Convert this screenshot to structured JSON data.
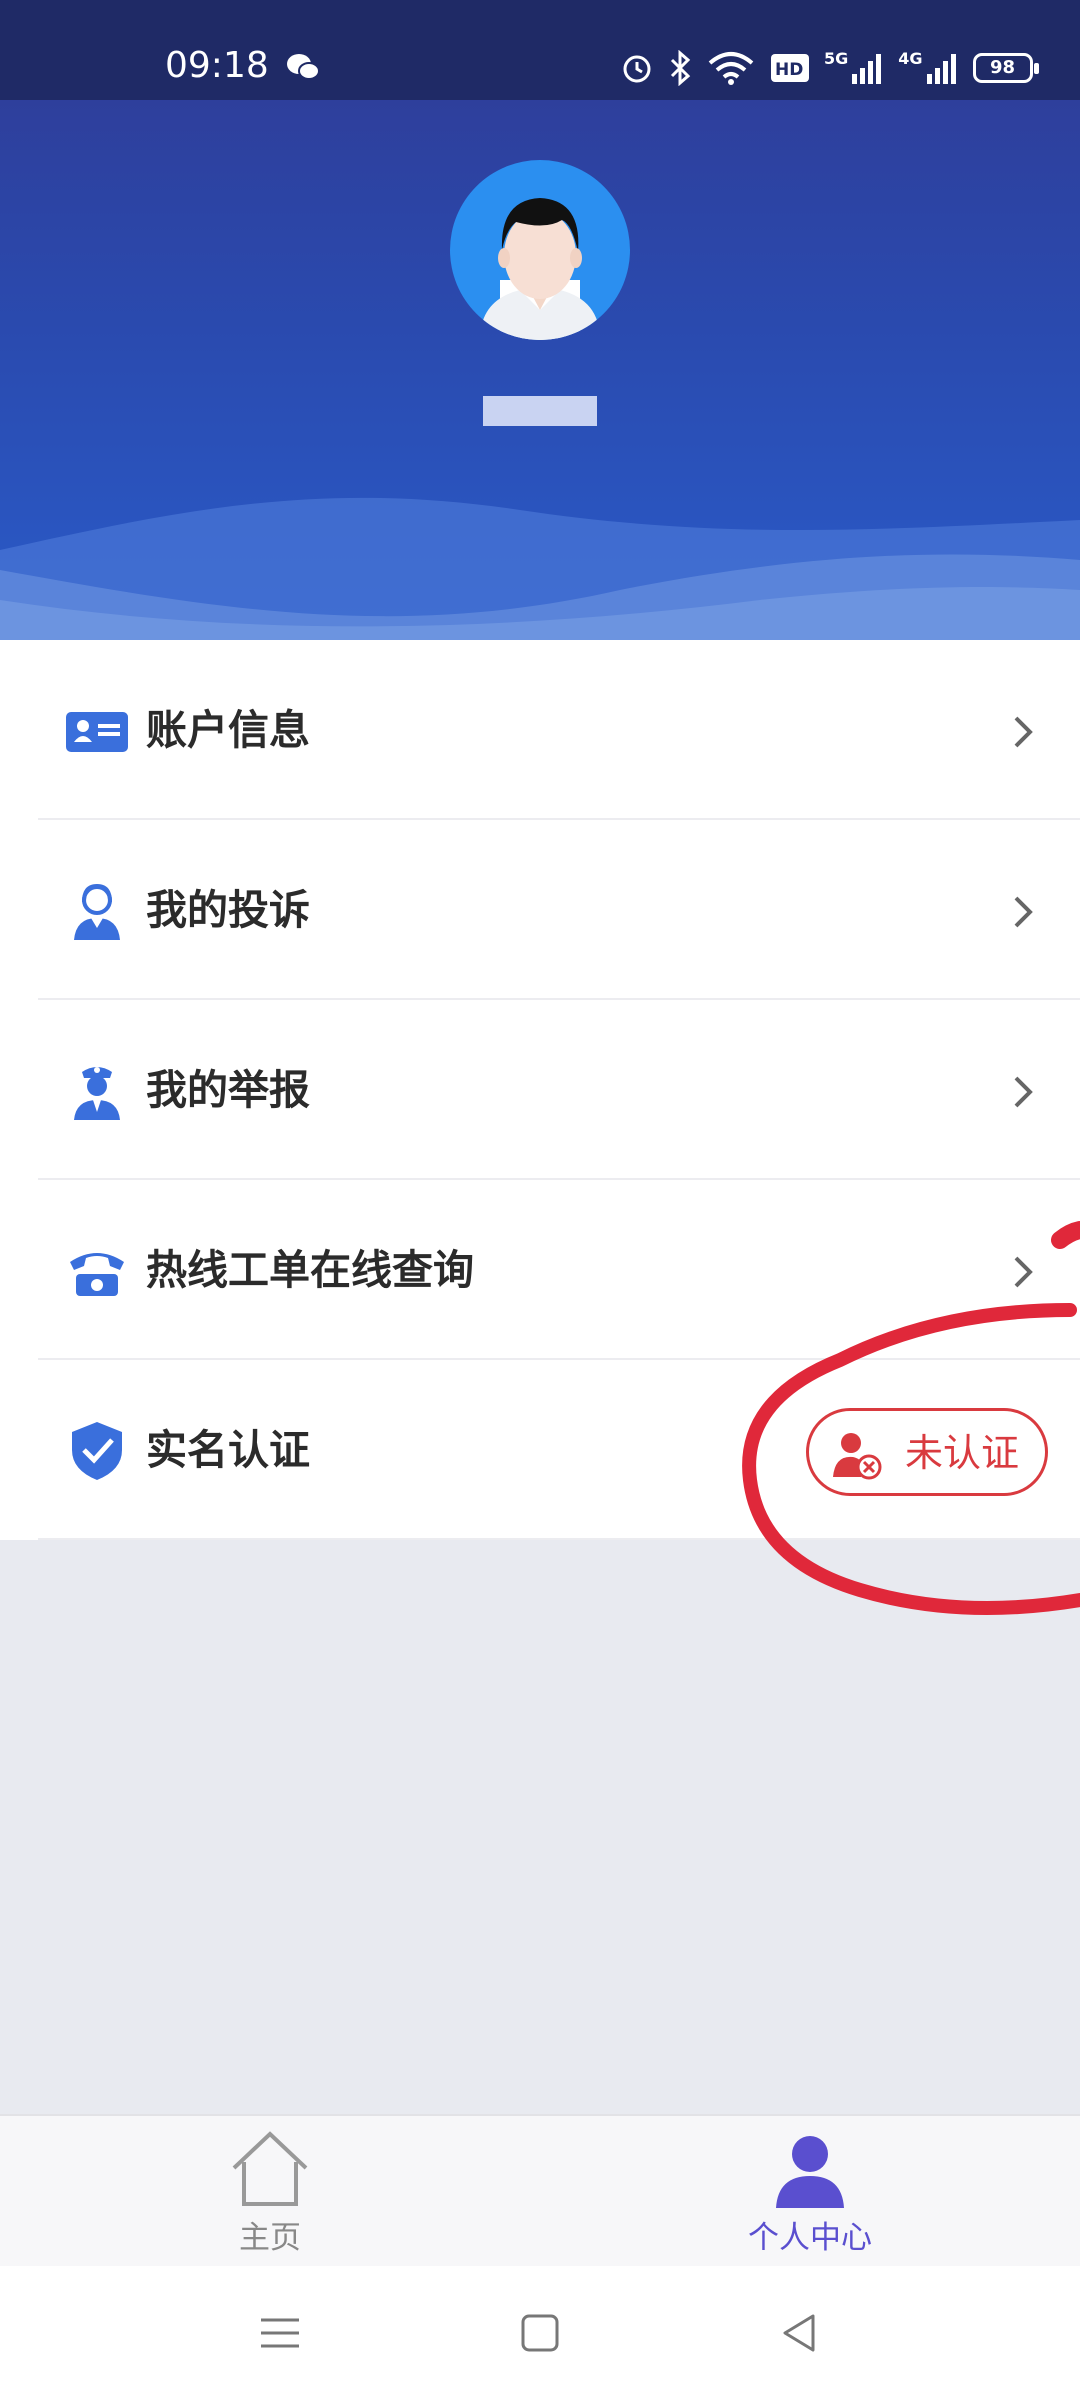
{
  "status_bar": {
    "time": "09:18",
    "battery": "98",
    "net1": "5G",
    "net2": "4G",
    "icons": [
      "wechat-icon",
      "alarm-icon",
      "bluetooth-icon",
      "wifi-icon",
      "hd-icon",
      "signal-icon",
      "battery-icon"
    ]
  },
  "header": {
    "username": "",
    "avatar": "avatar-icon"
  },
  "menu": {
    "items": [
      {
        "label": "账户信息",
        "icon": "id-card-icon"
      },
      {
        "label": "我的投诉",
        "icon": "agent-icon"
      },
      {
        "label": "我的举报",
        "icon": "officer-icon"
      },
      {
        "label": "热线工单在线查询",
        "icon": "telephone-icon"
      },
      {
        "label": "实名认证",
        "icon": "shield-check-icon"
      }
    ],
    "verify_badge": {
      "label": "未认证",
      "color": "#d93a3f"
    }
  },
  "bottom_nav": {
    "tabs": [
      {
        "label": "主页",
        "icon": "home-icon"
      },
      {
        "label": "个人中心",
        "icon": "user-icon",
        "active": true
      }
    ]
  },
  "colors": {
    "accent": "#3a6fdc",
    "header": "#2a4bb0",
    "active_tab": "#5a4fcf",
    "annotation": "#e0283a"
  }
}
